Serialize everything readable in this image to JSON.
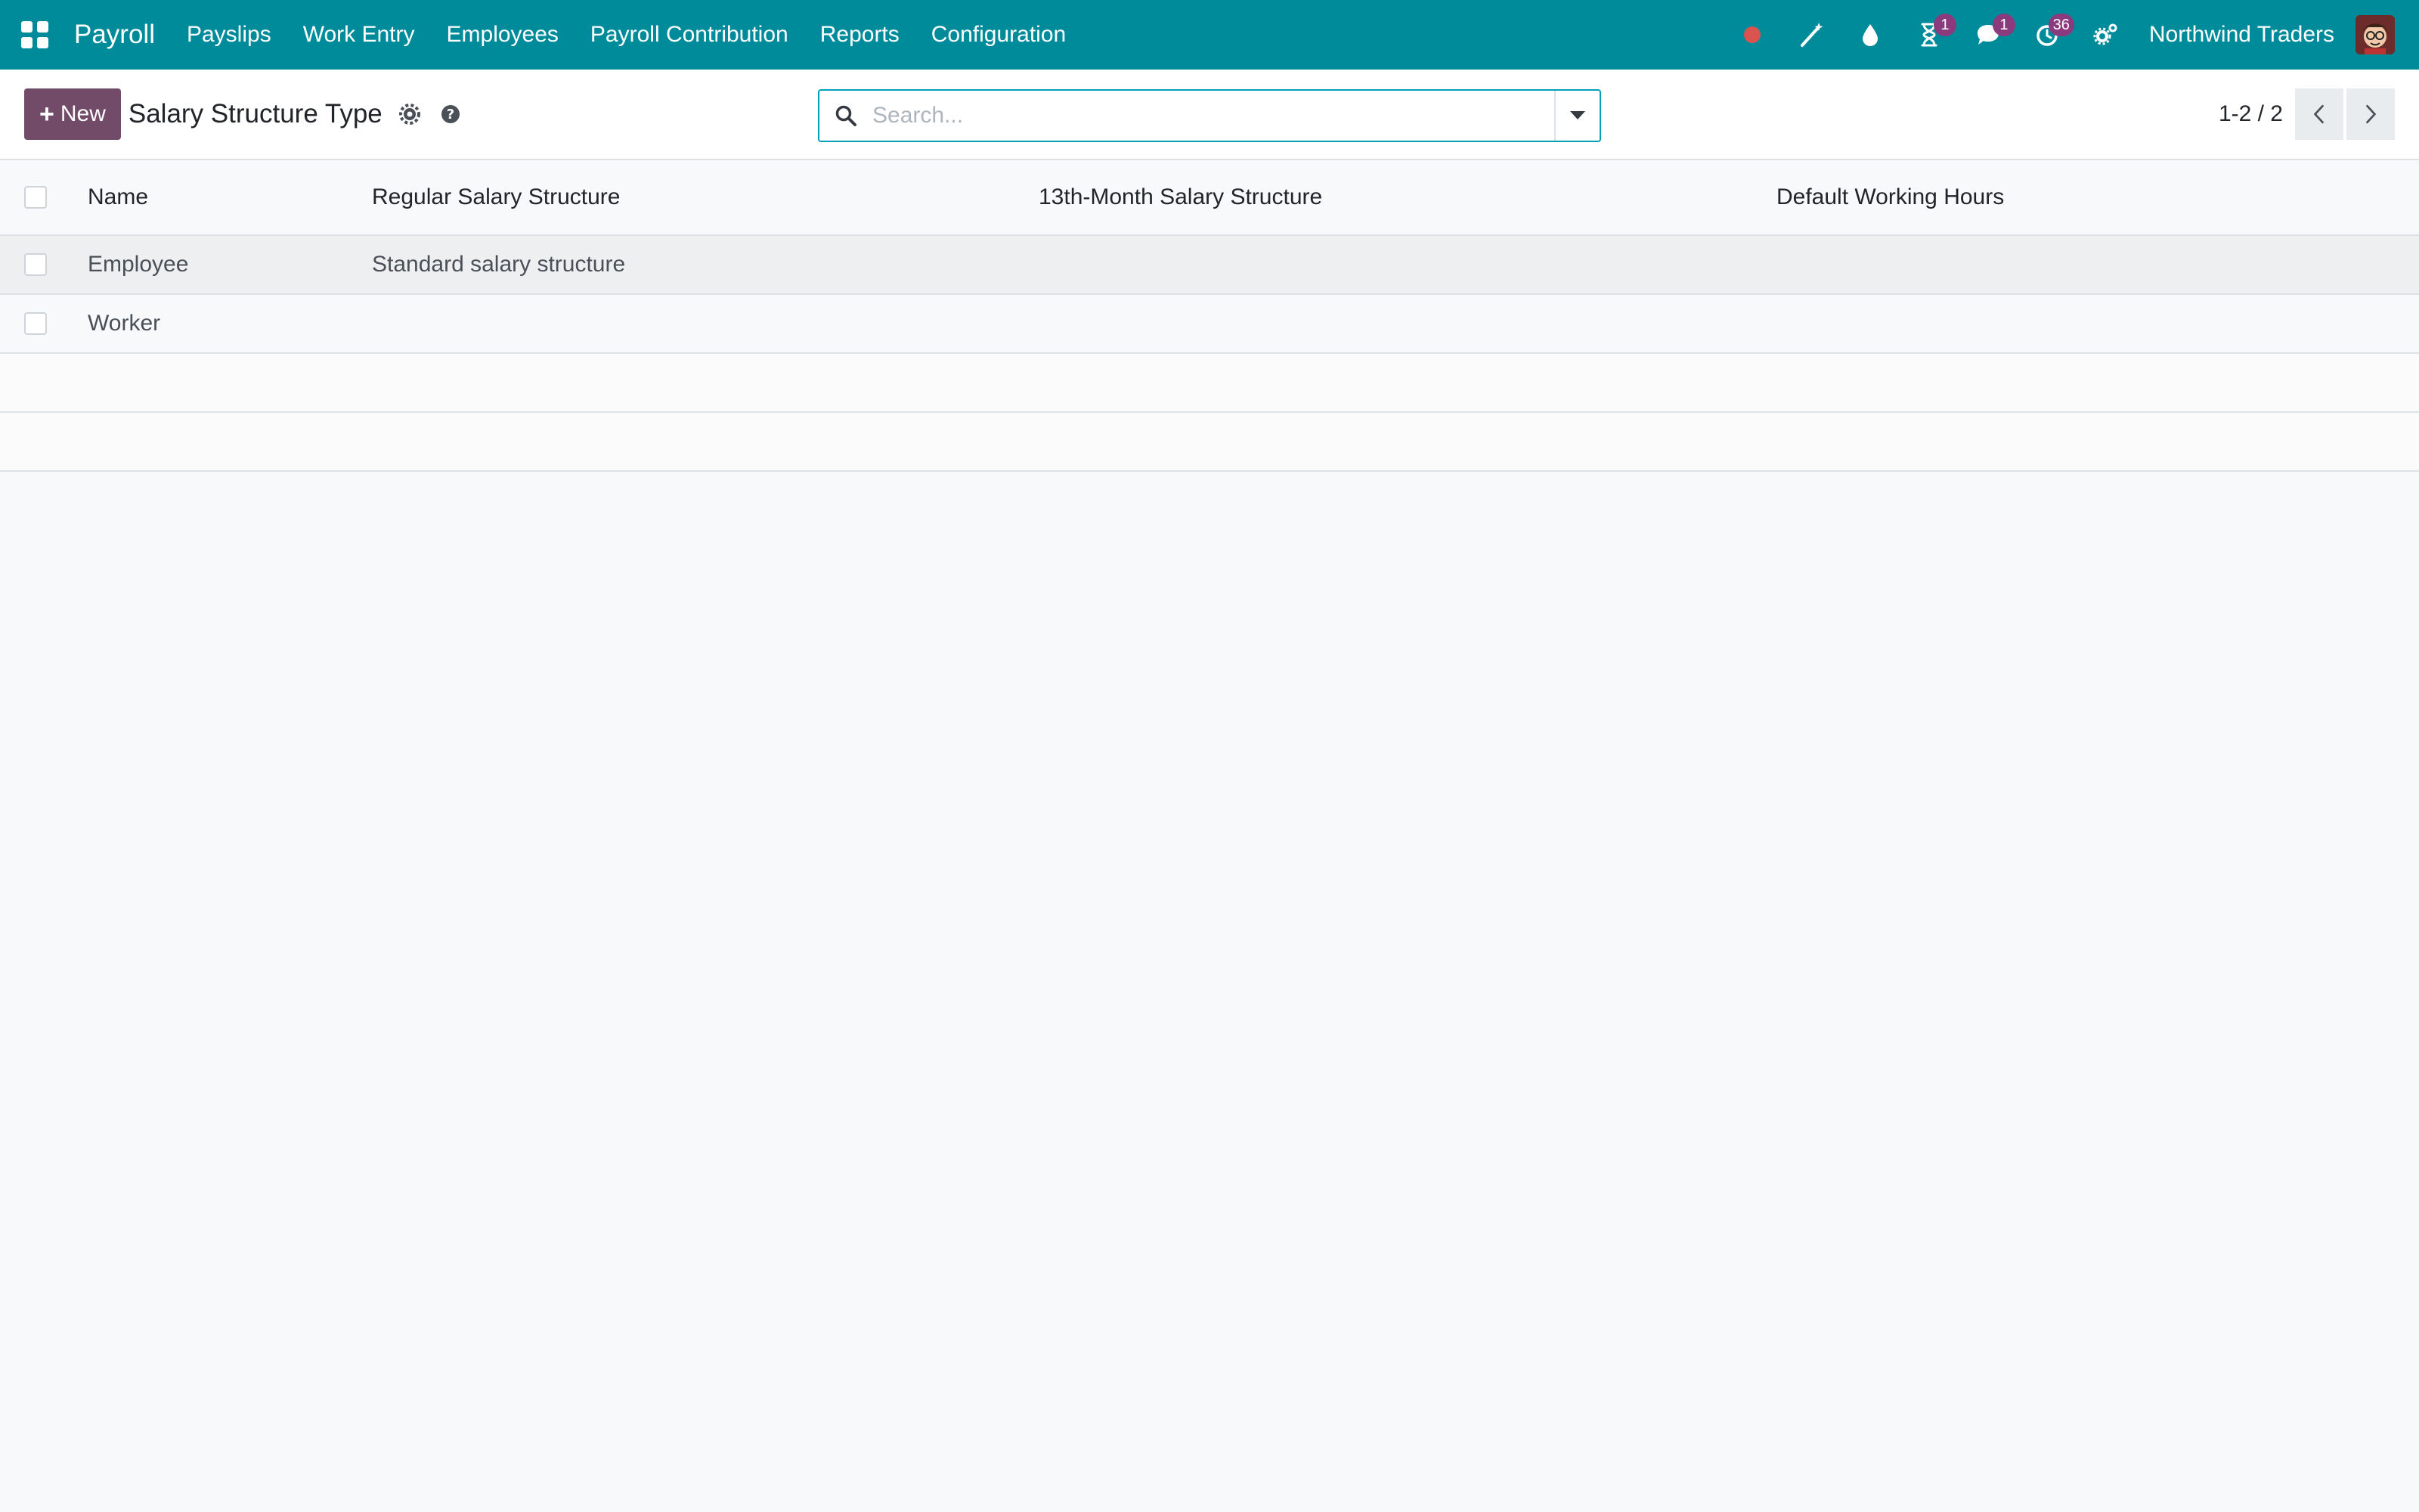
{
  "navbar": {
    "app_name": "Payroll",
    "menu": [
      "Payslips",
      "Work Entry",
      "Employees",
      "Payroll Contribution",
      "Reports",
      "Configuration"
    ],
    "activity_badge": "1",
    "messages_badge": "1",
    "timer_badge": "36",
    "company": "Northwind Traders",
    "colors": {
      "bar": "#008b9b",
      "badge": "#8b3a7e",
      "record_dot": "#d9534f"
    }
  },
  "control_panel": {
    "new_label": "New",
    "title": "Salary Structure Type",
    "search_placeholder": "Search...",
    "pager_value": "1-2 / 2",
    "new_color": "#714b67"
  },
  "table": {
    "headers": {
      "name": "Name",
      "regular": "Regular Salary Structure",
      "thirteenth": "13th-Month Salary Structure",
      "hours": "Default Working Hours"
    },
    "rows": [
      {
        "name": "Employee",
        "regular": "Standard salary structure",
        "thirteenth": "",
        "hours": ""
      },
      {
        "name": "Worker",
        "regular": "",
        "thirteenth": "",
        "hours": ""
      }
    ]
  }
}
